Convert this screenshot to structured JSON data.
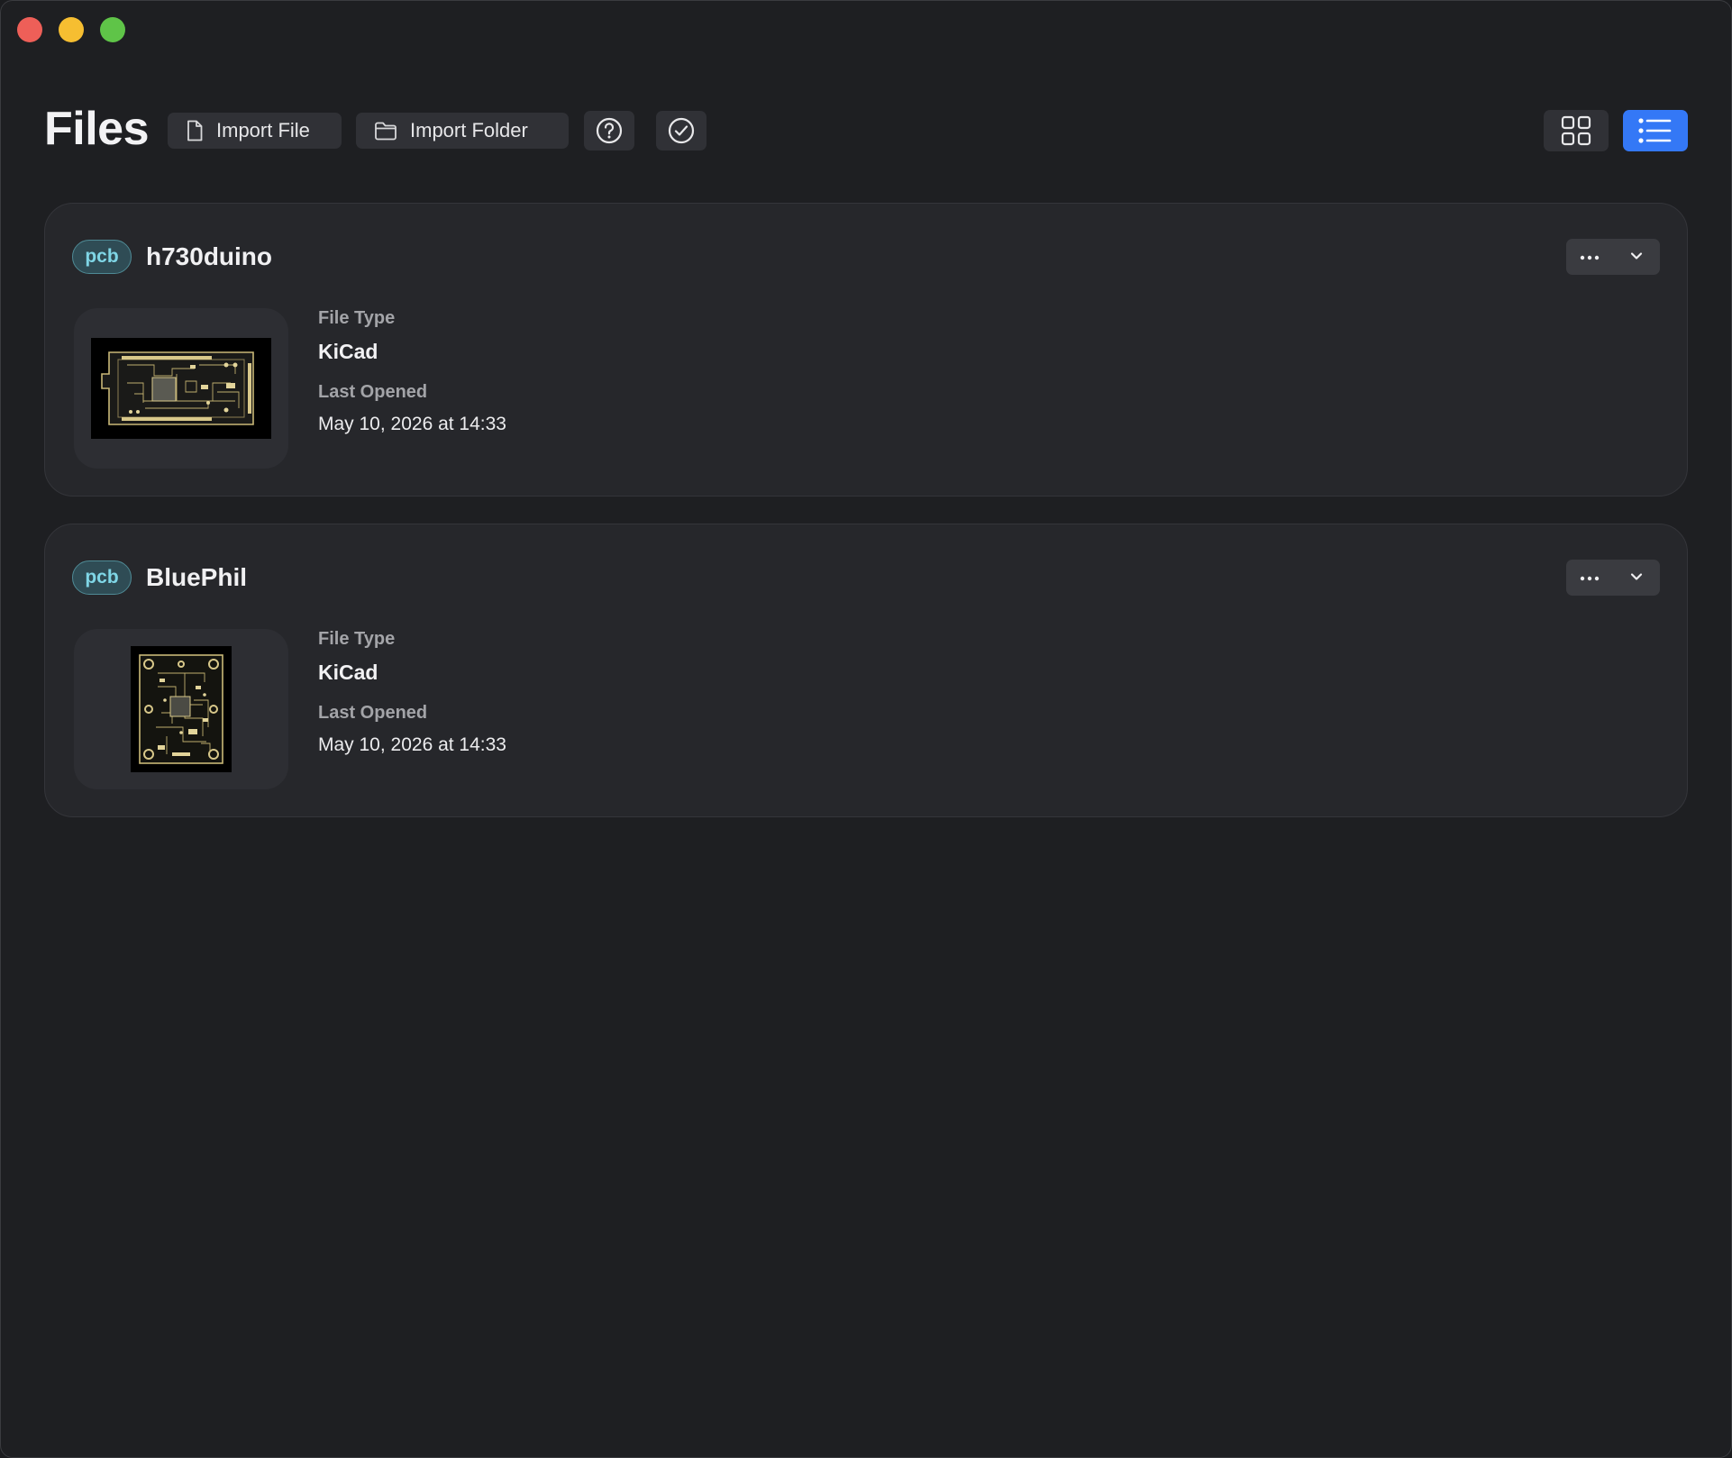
{
  "window": {
    "title": "Files"
  },
  "toolbar": {
    "import_file_label": "Import File",
    "import_folder_label": "Import Folder",
    "icons": {
      "import_file": "document-icon",
      "import_folder": "folder-icon",
      "help": "question-circle-icon",
      "check": "checkmark-circle-icon",
      "grid_view": "grid-view-icon",
      "list_view": "list-view-icon"
    },
    "active_view": "list",
    "accent_color": "#3478f6"
  },
  "files": [
    {
      "badge": "pcb",
      "name": "h730duino",
      "file_type_label": "File Type",
      "file_type": "KiCad",
      "last_opened_label": "Last Opened",
      "last_opened": "May 10, 2026 at 14:33",
      "thumbnail": "pcb-board-wide-thumbnail"
    },
    {
      "badge": "pcb",
      "name": "BluePhil",
      "file_type_label": "File Type",
      "file_type": "KiCad",
      "last_opened_label": "Last Opened",
      "last_opened": "May 10, 2026 at 14:33",
      "thumbnail": "pcb-board-square-thumbnail"
    }
  ]
}
